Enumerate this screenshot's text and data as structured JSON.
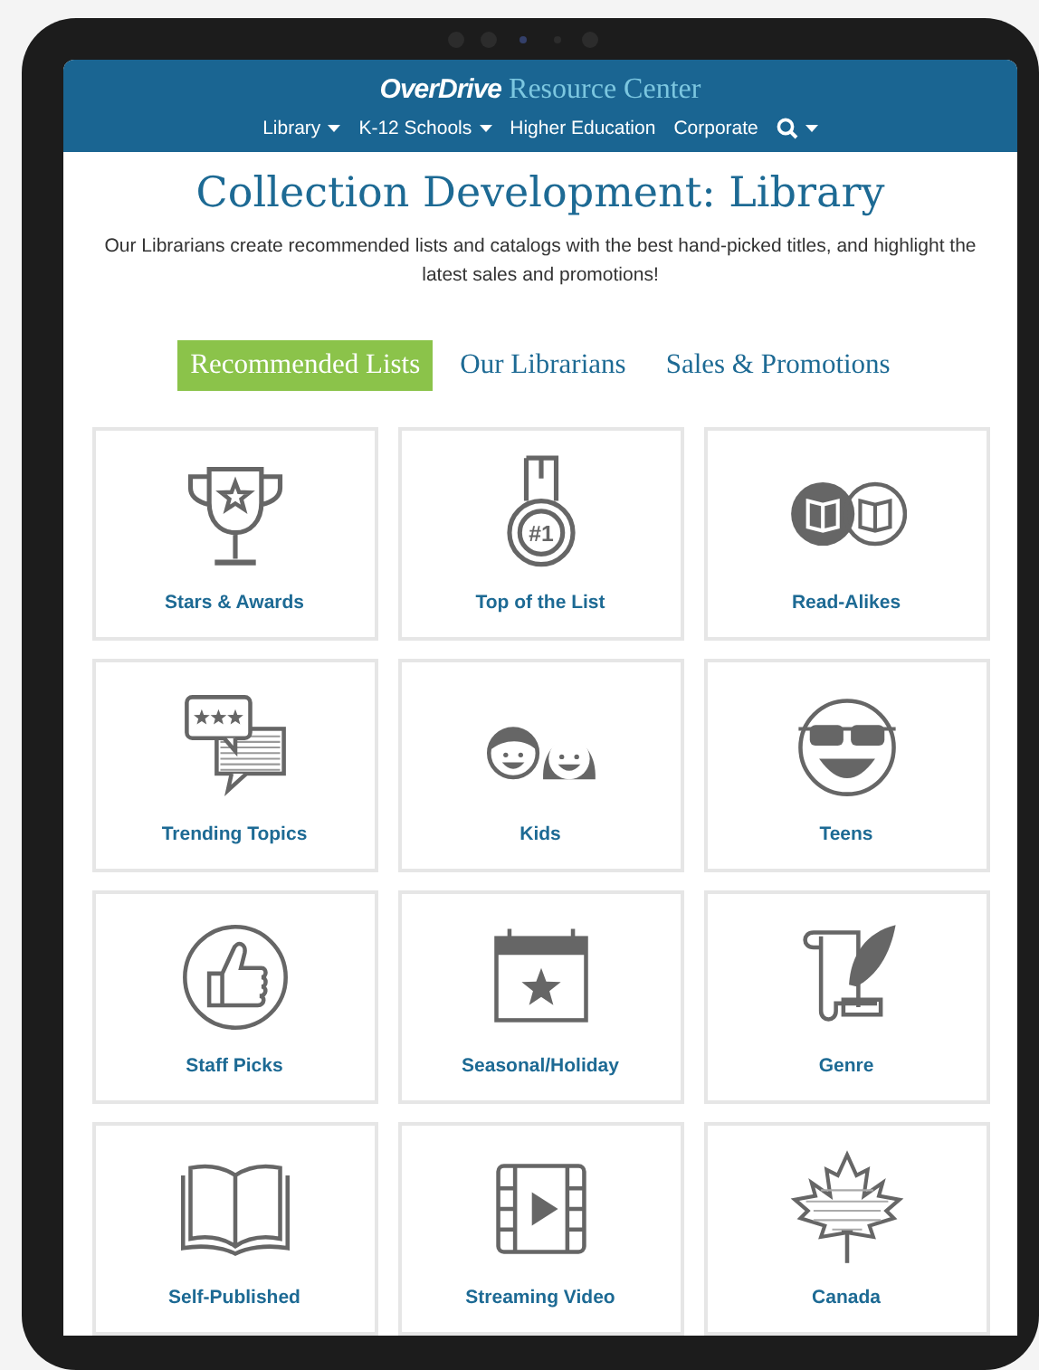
{
  "header": {
    "logo_brand": "OverDrive",
    "logo_product": "Resource Center",
    "nav": [
      {
        "kind": "link",
        "label": "Library",
        "dropdown": true
      },
      {
        "kind": "link",
        "label": "K-12 Schools",
        "dropdown": true
      },
      {
        "kind": "link",
        "label": "Higher Education",
        "dropdown": false
      },
      {
        "kind": "link",
        "label": "Corporate",
        "dropdown": false
      },
      {
        "kind": "search",
        "dropdown": true
      }
    ]
  },
  "page": {
    "title": "Collection Development: Library",
    "intro": "Our Librarians create recommended lists and catalogs with the best hand-picked titles, and highlight the latest sales and promotions!"
  },
  "tabs": [
    {
      "label": "Recommended Lists",
      "selected": true
    },
    {
      "label": "Our Librarians",
      "selected": false
    },
    {
      "label": "Sales & Promotions",
      "selected": false
    }
  ],
  "cards": [
    {
      "label": "Stars & Awards",
      "kind": "trophy"
    },
    {
      "label": "Top of the List",
      "kind": "medal"
    },
    {
      "label": "Read-Alikes",
      "kind": "books"
    },
    {
      "label": "Trending Topics",
      "kind": "bubbles"
    },
    {
      "label": "Kids",
      "kind": "kids"
    },
    {
      "label": "Teens",
      "kind": "teens"
    },
    {
      "label": "Staff Picks",
      "kind": "thumb"
    },
    {
      "label": "Seasonal/Holiday",
      "kind": "calendar"
    },
    {
      "label": "Genre",
      "kind": "quill"
    },
    {
      "label": "Self-Published",
      "kind": "openbook"
    },
    {
      "label": "Streaming Video",
      "kind": "film"
    },
    {
      "label": "Canada",
      "kind": "leaf"
    }
  ],
  "medal_icon_text": "#1"
}
